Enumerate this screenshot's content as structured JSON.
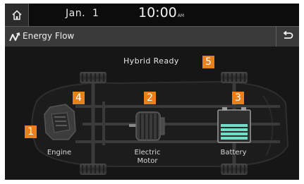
{
  "status_bar": {
    "home_icon": "home-icon",
    "date": "Jan.  1",
    "time": "10:00",
    "ampm": "AM"
  },
  "title_bar": {
    "icon": "energy-flow-icon",
    "title": "Energy Flow",
    "back_icon": "back-arrow-icon"
  },
  "main": {
    "status_text": "Hybrid Ready",
    "callouts": [
      "1",
      "2",
      "3",
      "4",
      "5"
    ],
    "components": {
      "engine": "Engine",
      "motor_line1": "Electric",
      "motor_line2": "Motor",
      "battery": "Battery"
    }
  },
  "colors": {
    "badge": "#e9801c",
    "battery_cells": "#6fe0c8",
    "background": "#161616"
  }
}
